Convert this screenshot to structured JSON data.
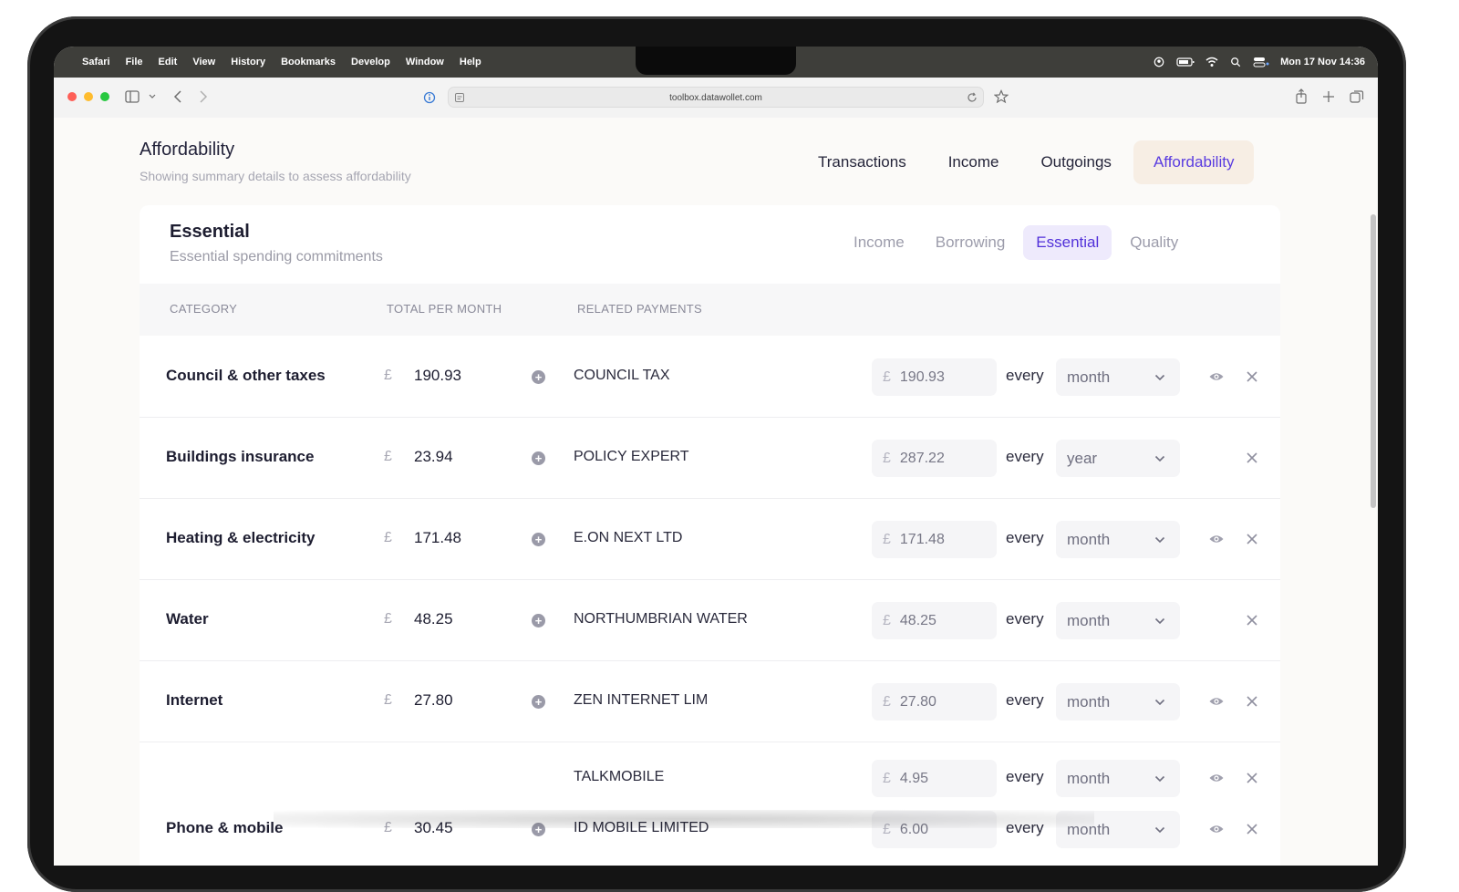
{
  "menubar": {
    "app": "Safari",
    "items": [
      "File",
      "Edit",
      "View",
      "History",
      "Bookmarks",
      "Develop",
      "Window",
      "Help"
    ],
    "clock": "Mon 17 Nov  14:36"
  },
  "browser": {
    "url": "toolbox.datawollet.com"
  },
  "page": {
    "title": "Affordability",
    "subtitle": "Showing summary details to assess affordability",
    "nav": [
      "Transactions",
      "Income",
      "Outgoings",
      "Affordability"
    ],
    "nav_active": "Affordability"
  },
  "card": {
    "title": "Essential",
    "subtitle": "Essential spending commitments",
    "tabs": [
      "Income",
      "Borrowing",
      "Essential",
      "Quality"
    ],
    "tab_active": "Essential",
    "columns": [
      "CATEGORY",
      "TOTAL PER MONTH",
      "RELATED PAYMENTS"
    ],
    "currency_symbol": "£",
    "every_label": "every",
    "rows": [
      {
        "category": "Council & other taxes",
        "total": "190.93",
        "payments": [
          {
            "payee": "COUNCIL TAX",
            "amount": "190.93",
            "frequency": "month",
            "eye": true
          }
        ]
      },
      {
        "category": "Buildings insurance",
        "total": "23.94",
        "payments": [
          {
            "payee": "POLICY EXPERT",
            "amount": "287.22",
            "frequency": "year",
            "eye": false
          }
        ]
      },
      {
        "category": "Heating & electricity",
        "total": "171.48",
        "payments": [
          {
            "payee": "E.ON NEXT LTD",
            "amount": "171.48",
            "frequency": "month",
            "eye": true
          }
        ]
      },
      {
        "category": "Water",
        "total": "48.25",
        "payments": [
          {
            "payee": "NORTHUMBRIAN WATER",
            "amount": "48.25",
            "frequency": "month",
            "eye": false
          }
        ]
      },
      {
        "category": "Internet",
        "total": "27.80",
        "payments": [
          {
            "payee": "ZEN INTERNET LIM",
            "amount": "27.80",
            "frequency": "month",
            "eye": true
          }
        ]
      },
      {
        "category": "Phone & mobile",
        "total": "30.45",
        "payments": [
          {
            "payee": "TALKMOBILE",
            "amount": "4.95",
            "frequency": "month",
            "eye": true
          },
          {
            "payee": "ID MOBILE LIMITED",
            "amount": "6.00",
            "frequency": "month",
            "eye": true
          }
        ]
      }
    ]
  },
  "colors": {
    "accent": "#5130d9",
    "active_tab_bg": "#f7eee4",
    "sub_tab_bg": "#eeeafc"
  }
}
